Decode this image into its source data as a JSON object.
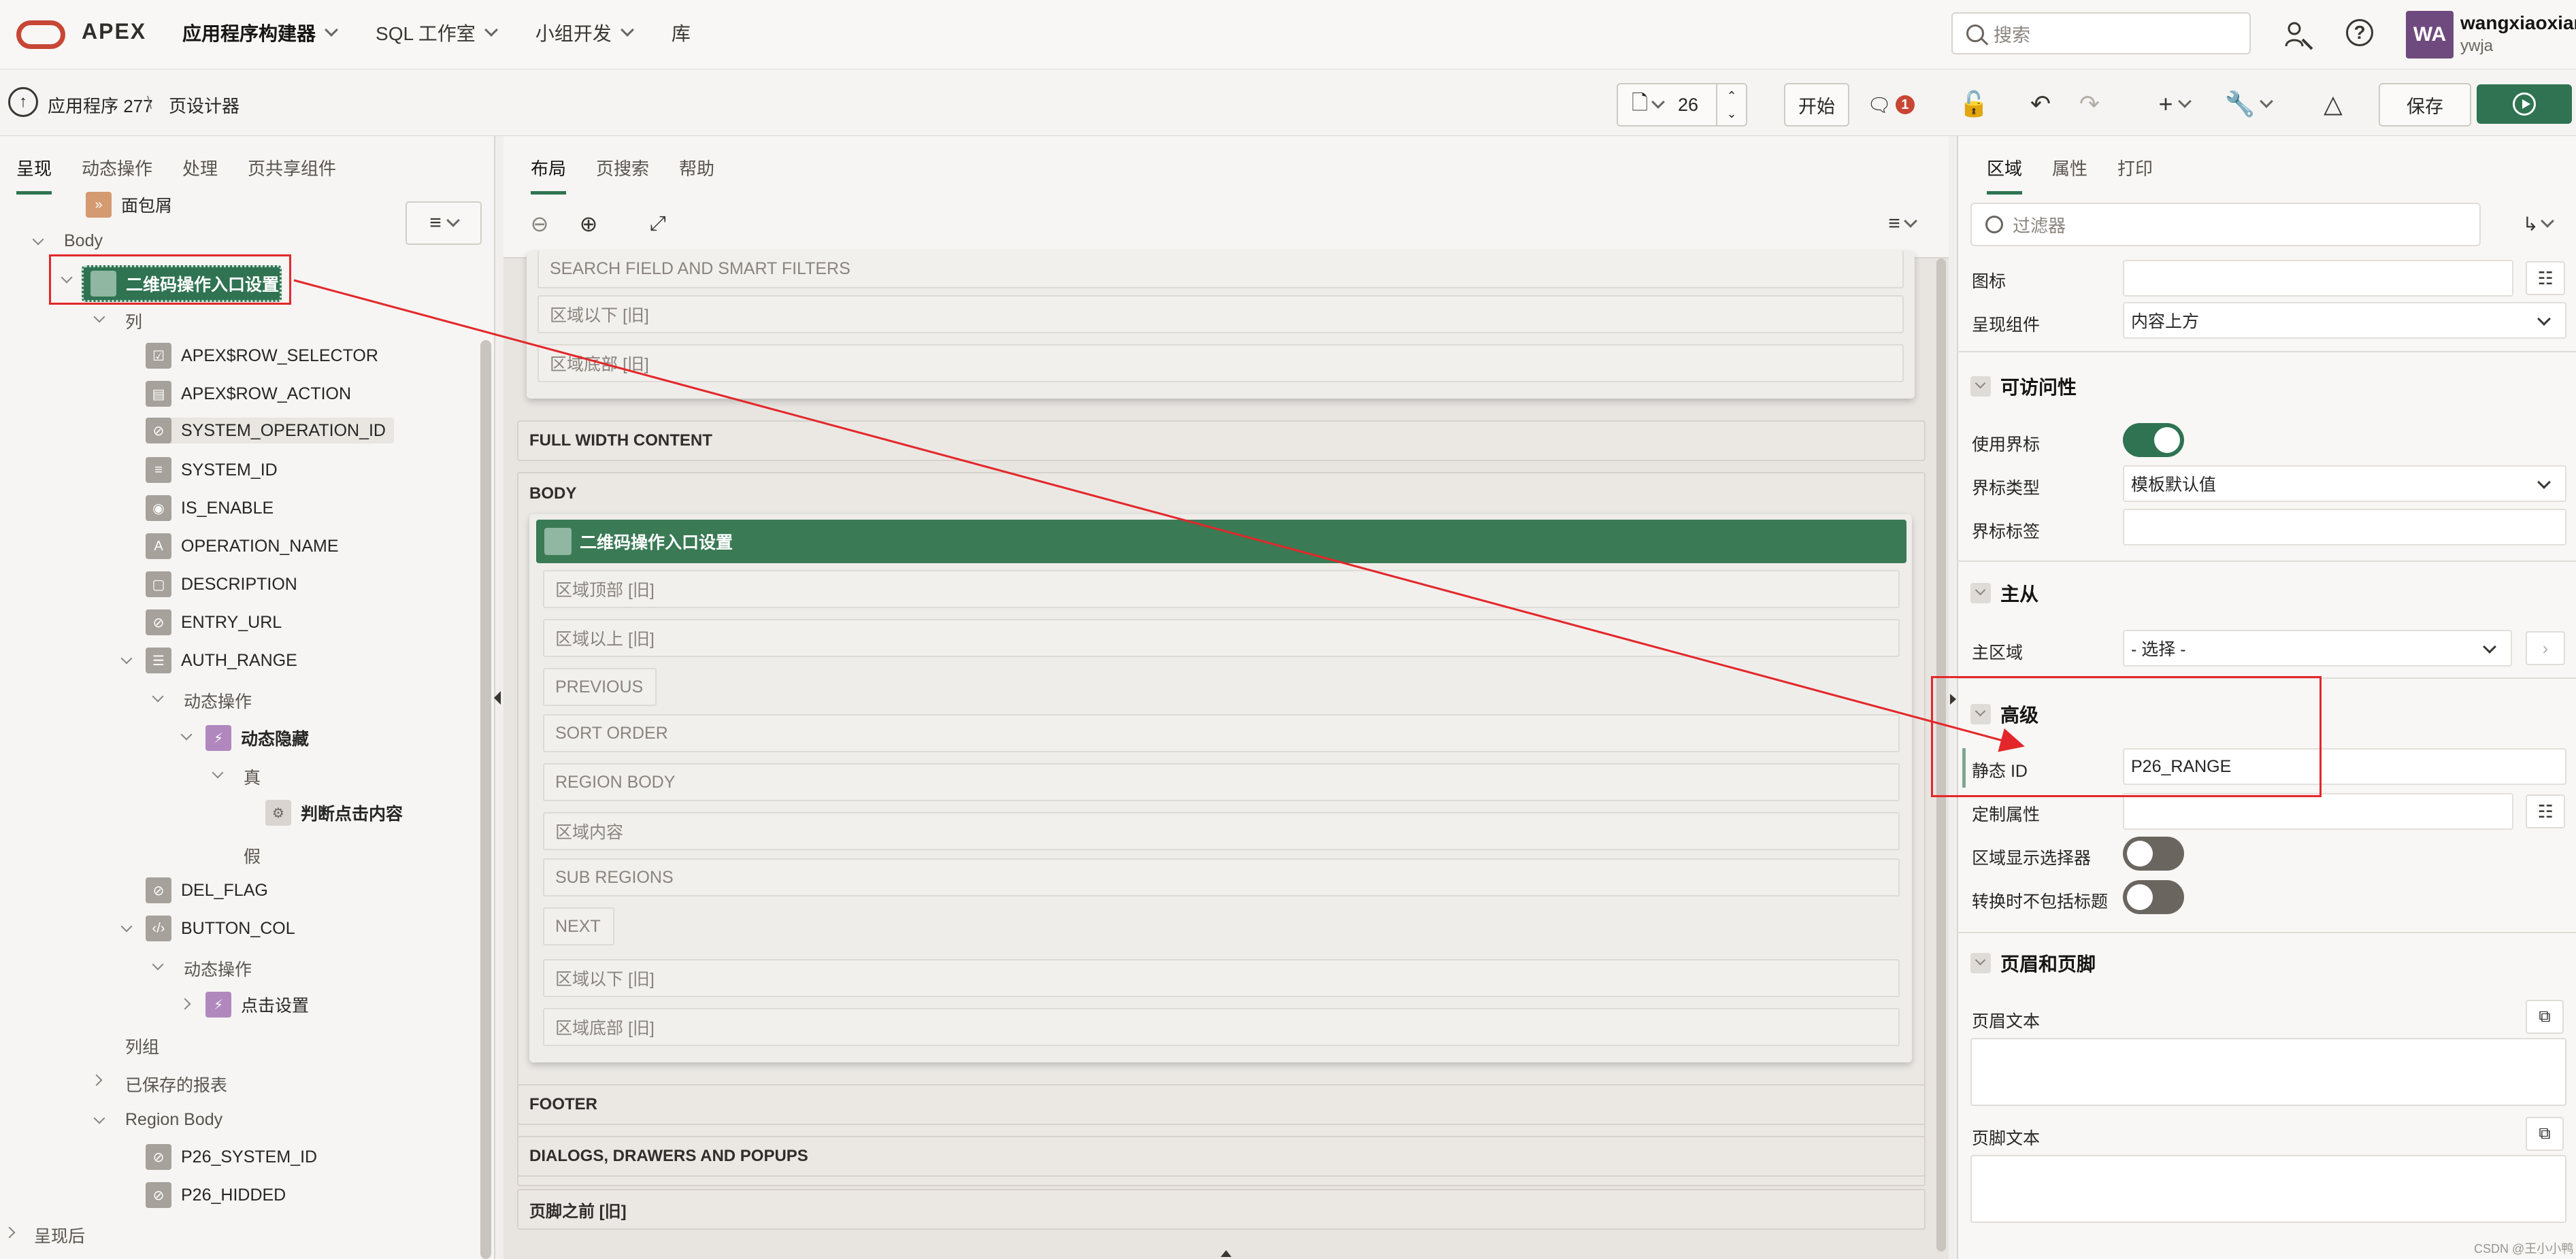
{
  "topnav": {
    "brand": "APEX",
    "items": [
      {
        "label": "应用程序构建器",
        "active": true
      },
      {
        "label": "SQL 工作室"
      },
      {
        "label": "小组开发"
      },
      {
        "label": "库"
      }
    ],
    "search_placeholder": "搜索",
    "user_initials": "WA",
    "user_name": "wangxiaoxian",
    "workspace": "ywja"
  },
  "toolbar": {
    "breadcrumb_app": "应用程序 277",
    "breadcrumb_page": "页设计器",
    "page_number": "26",
    "start_label": "开始",
    "issue_count": "1",
    "save_label": "保存"
  },
  "left": {
    "tabs": [
      "呈现",
      "动态操作",
      "处理",
      "页共享组件"
    ],
    "tree": {
      "breadcrumb": "面包屑",
      "body": "Body",
      "region": "二维码操作入口设置",
      "columns": "列",
      "col_items": [
        "APEX$ROW_SELECTOR",
        "APEX$ROW_ACTION",
        "SYSTEM_OPERATION_ID",
        "SYSTEM_ID",
        "IS_ENABLE",
        "OPERATION_NAME",
        "DESCRIPTION",
        "ENTRY_URL",
        "AUTH_RANGE"
      ],
      "dyn_actions": "动态操作",
      "dyn_hide": "动态隐藏",
      "true_label": "真",
      "action_judge": "判断点击内容",
      "false_label": "假",
      "del_flag": "DEL_FLAG",
      "button_col": "BUTTON_COL",
      "dyn_actions2": "动态操作",
      "click_setting": "点击设置",
      "col_group": "列组",
      "saved_reports": "已保存的报表",
      "region_body": "Region Body",
      "p26_system_id": "P26_SYSTEM_ID",
      "p26_hidded": "P26_HIDDED",
      "after_render": "呈现后"
    }
  },
  "middle": {
    "tabs": [
      "布局",
      "页搜索",
      "帮助"
    ],
    "top_slots": [
      "SEARCH FIELD AND SMART FILTERS",
      "区域以下 [旧]",
      "区域底部 [旧]"
    ],
    "full_width": "FULL WIDTH CONTENT",
    "body": "BODY",
    "region_title": "二维码操作入口设置",
    "region_slots": [
      "区域顶部 [旧]",
      "区域以上 [旧]",
      "PREVIOUS",
      "SORT ORDER",
      "REGION BODY",
      "区域内容",
      "SUB REGIONS",
      "NEXT",
      "区域以下 [旧]",
      "区域底部 [旧]"
    ],
    "footer": "FOOTER",
    "dialogs": "DIALOGS, DRAWERS AND POPUPS",
    "before_footer": "页脚之前 [旧]"
  },
  "right": {
    "tabs": [
      "区域",
      "属性",
      "打印"
    ],
    "filter_placeholder": "过滤器",
    "icon_label": "图标",
    "render_comp_label": "呈现组件",
    "render_comp_value": "内容上方",
    "sec_access": "可访问性",
    "use_landmark": "使用界标",
    "landmark_type": "界标类型",
    "landmark_type_value": "模板默认值",
    "landmark_label": "界标标签",
    "sec_master": "主从",
    "master_region": "主区域",
    "master_region_value": "- 选择 -",
    "sec_advanced": "高级",
    "static_id": "静态 ID",
    "static_id_value": "P26_RANGE",
    "custom_attrs": "定制属性",
    "region_selector": "区域显示选择器",
    "exclude_title": "转换时不包括标题",
    "sec_header_footer": "页眉和页脚",
    "header_text": "页眉文本",
    "footer_text": "页脚文本"
  },
  "watermark": "CSDN @王小小鸭",
  "colors": {
    "accent": "#2f7352",
    "annotation": "#e3272a",
    "oracle_red": "#c74634"
  }
}
